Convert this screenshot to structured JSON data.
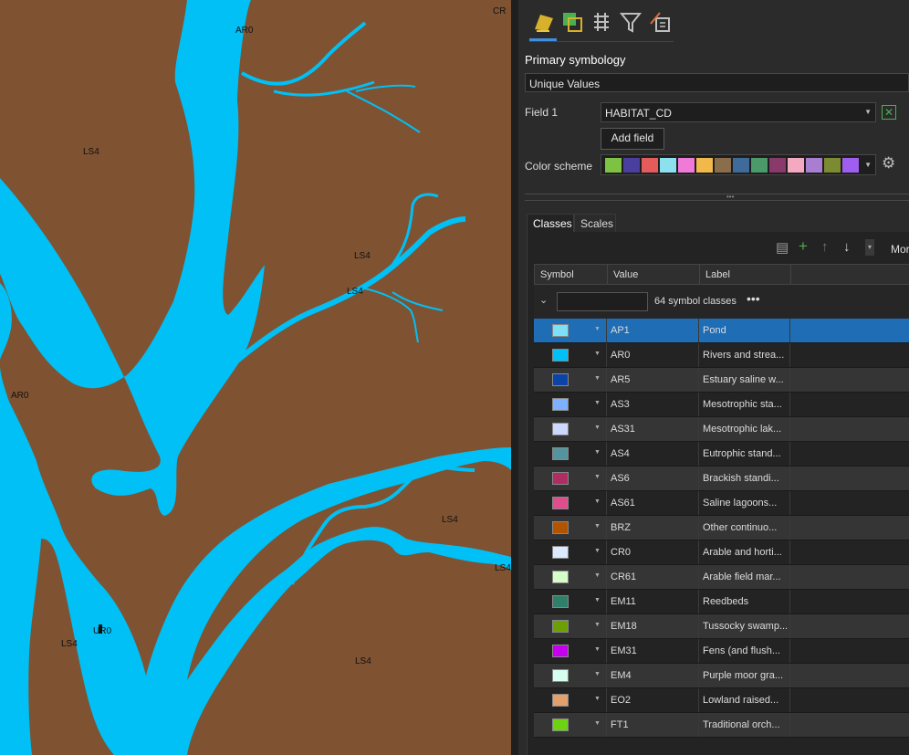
{
  "map": {
    "labels": [
      "AR0",
      "LS4",
      "LS4",
      "LS4",
      "AR0",
      "LS4",
      "LS4",
      "LS4",
      "LS4",
      "UR0",
      "CR"
    ],
    "colors": {
      "land": "#7f5232",
      "water": "#00c0f5"
    }
  },
  "panel": {
    "tab_icons": [
      "symbology-icon",
      "vary-by-attribute-icon",
      "label-layer-icon",
      "filter-icon",
      "more-symbology-icon"
    ],
    "title": "Primary symbology",
    "renderer": "Unique Values",
    "field1_label": "Field 1",
    "field1_value": "HABITAT_CD",
    "add_field": "Add field",
    "color_scheme_label": "Color scheme",
    "color_scheme": [
      "#7dc242",
      "#4a3f9f",
      "#e35b5b",
      "#8de0ee",
      "#f07ad8",
      "#f0b94a",
      "#8a6e4c",
      "#3f6b9a",
      "#4a9a6a",
      "#8a3a6a",
      "#f4a9c0",
      "#a97ed0",
      "#7c8a32",
      "#a05ef0"
    ],
    "tabs": [
      "Classes",
      "Scales"
    ],
    "more": "Mor",
    "columns": [
      "Symbol",
      "Value",
      "Label"
    ],
    "group_label": "64 symbol classes",
    "rows": [
      {
        "value": "AP1",
        "label": "Pond",
        "color": "#7de0f9"
      },
      {
        "value": "AR0",
        "label": "Rivers and strea...",
        "color": "#00c0f5"
      },
      {
        "value": "AR5",
        "label": "Estuary saline w...",
        "color": "#0b44a6"
      },
      {
        "value": "AS3",
        "label": "Mesotrophic sta...",
        "color": "#7fb0ff"
      },
      {
        "value": "AS31",
        "label": "Mesotrophic lak...",
        "color": "#cdd8ff"
      },
      {
        "value": "AS4",
        "label": "Eutrophic stand...",
        "color": "#55949e"
      },
      {
        "value": "AS6",
        "label": "Brackish standi...",
        "color": "#b02d63"
      },
      {
        "value": "AS61",
        "label": "Saline lagoons...",
        "color": "#df4d8d"
      },
      {
        "value": "BRZ",
        "label": "Other continuo...",
        "color": "#b25300"
      },
      {
        "value": "CR0",
        "label": "Arable and horti...",
        "color": "#dbeaff"
      },
      {
        "value": "CR61",
        "label": "Arable field mar...",
        "color": "#d6ffc8"
      },
      {
        "value": "EM11",
        "label": "Reedbeds",
        "color": "#2e806a"
      },
      {
        "value": "EM18",
        "label": "Tussocky swamp...",
        "color": "#6c9e06"
      },
      {
        "value": "EM31",
        "label": "Fens (and flush...",
        "color": "#c600ee"
      },
      {
        "value": "EM4",
        "label": "Purple moor gra...",
        "color": "#d6fff0"
      },
      {
        "value": "EO2",
        "label": "Lowland raised...",
        "color": "#e4a06a"
      },
      {
        "value": "FT1",
        "label": "Traditional orch...",
        "color": "#6cd212"
      }
    ]
  }
}
